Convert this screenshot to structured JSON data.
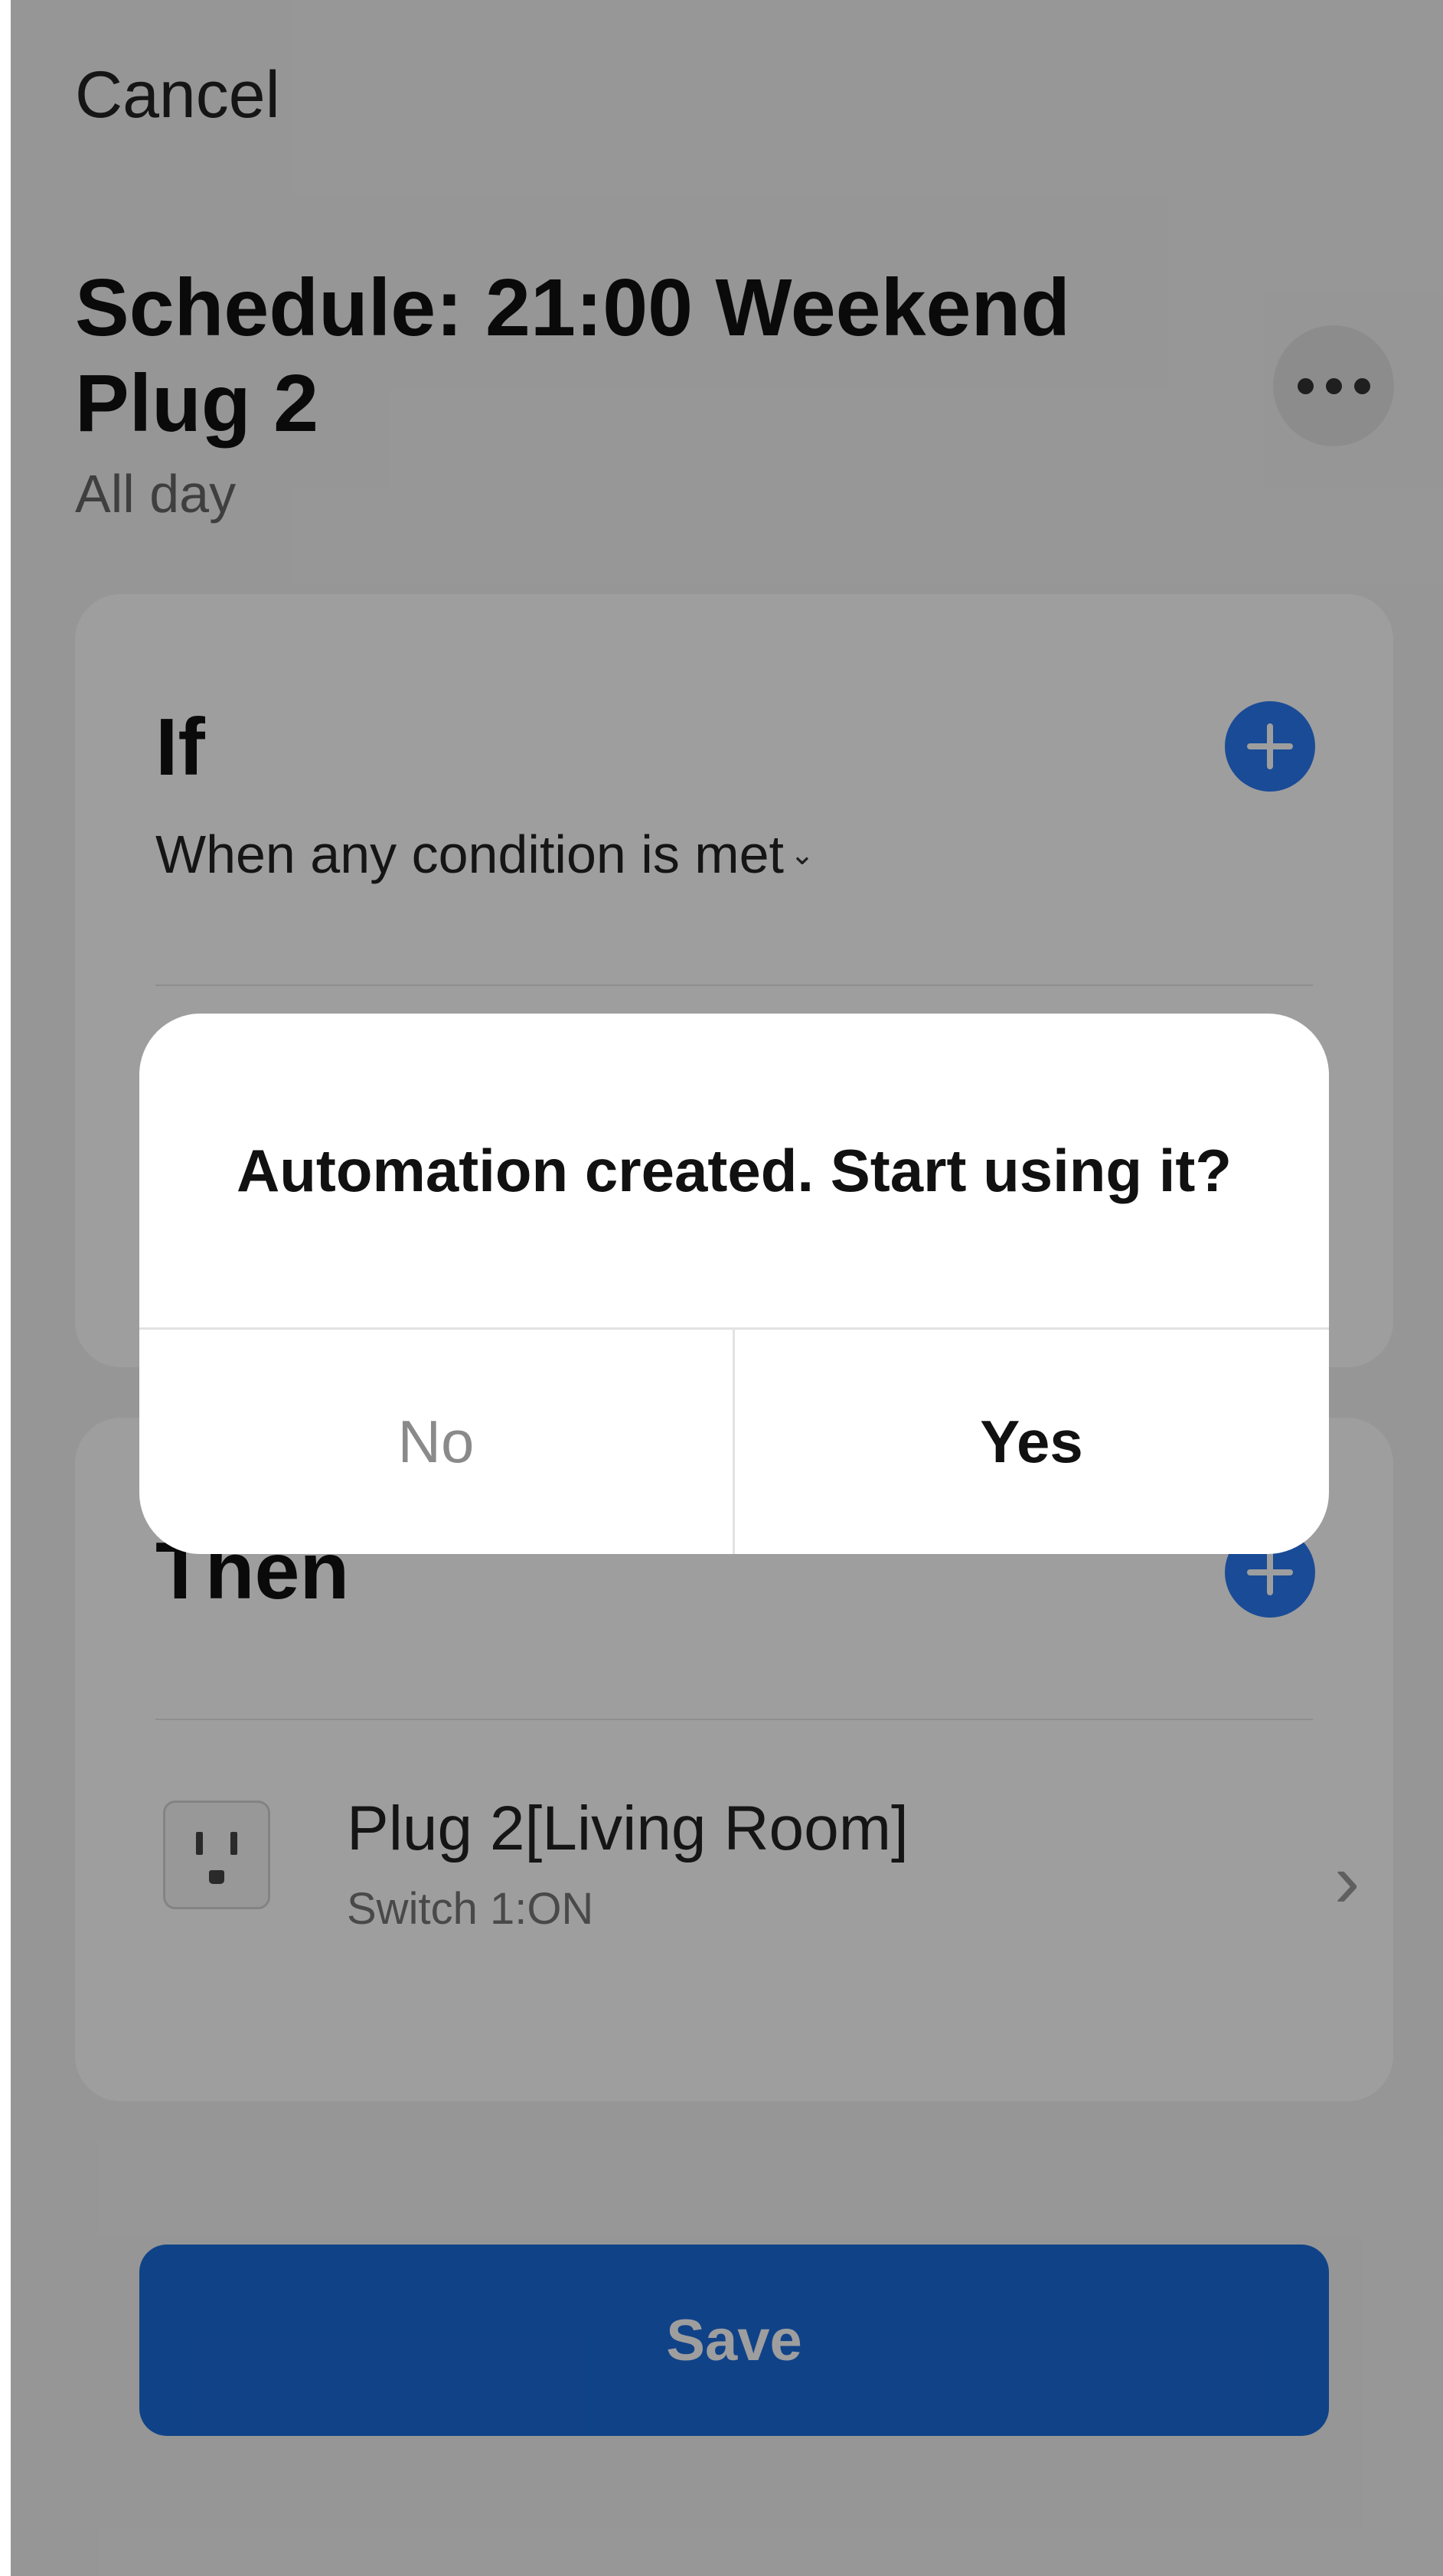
{
  "header": {
    "cancel_label": "Cancel",
    "title": "Schedule: 21:00 Weekend Plug 2",
    "subtitle": "All day",
    "more_icon": "more-horizontal-icon"
  },
  "if_section": {
    "title": "If",
    "condition_mode": "When any condition is met",
    "add_icon": "plus-icon"
  },
  "then_section": {
    "title": "Then",
    "add_icon": "plus-icon",
    "actions": [
      {
        "device": "Plug 2[Living Room]",
        "detail": "Switch 1:ON",
        "icon": "plug-icon"
      }
    ]
  },
  "save_label": "Save",
  "dialog": {
    "message": "Automation created. Start using it?",
    "no_label": "No",
    "yes_label": "Yes"
  },
  "colors": {
    "accent": "#2a7af3",
    "save_button": "#1b6bdc",
    "overlay": "rgba(0,0,0,0.38)"
  }
}
